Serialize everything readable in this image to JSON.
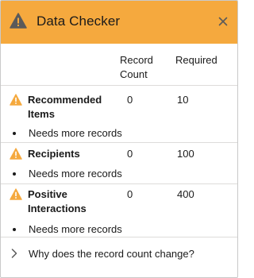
{
  "header": {
    "title": "Data Checker",
    "icon": "warning-icon",
    "close_icon": "close-icon",
    "background": "#f5a93e"
  },
  "columns": {
    "record_count_line1": "Record",
    "record_count_line2": "Count",
    "required": "Required"
  },
  "rows": [
    {
      "name_line1": "Recommended",
      "name_line2": "Items",
      "count": "0",
      "required": "10",
      "note": "Needs more records",
      "icon": "warning-icon"
    },
    {
      "name_line1": "Recipients",
      "name_line2": "",
      "count": "0",
      "required": "100",
      "note": "Needs more records",
      "icon": "warning-icon"
    },
    {
      "name_line1": "Positive",
      "name_line2": "Interactions",
      "count": "0",
      "required": "400",
      "note": "Needs more records",
      "icon": "warning-icon"
    }
  ],
  "footer": {
    "label": "Why does the record count change?",
    "icon": "chevron-right-icon"
  },
  "colors": {
    "warning": "#f5a93e",
    "warning_icon_header": "#5a5a5a",
    "text": "#1a1a1a",
    "divider": "#dddbda"
  }
}
